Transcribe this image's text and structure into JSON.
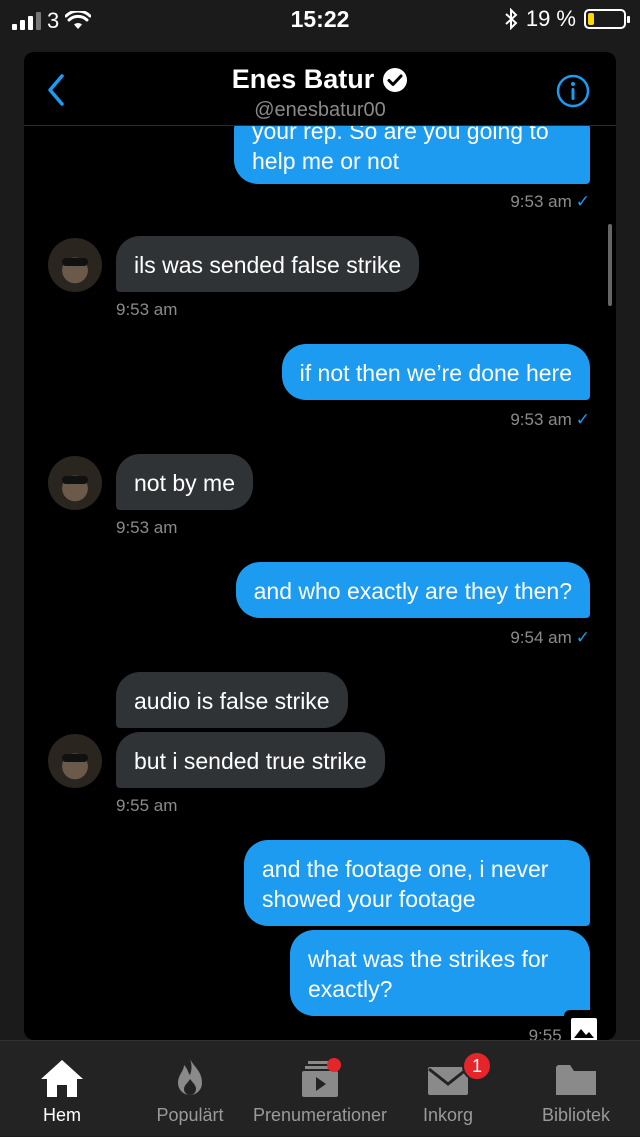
{
  "status_bar": {
    "carrier": "3",
    "time": "15:22",
    "battery_percent": "19 %",
    "battery_level": 0.19,
    "battery_color": "#ffd60a"
  },
  "header": {
    "name": "Enes Batur",
    "handle": "@enesbatur00",
    "verified": true
  },
  "messages": [
    {
      "type": "sent",
      "text": "your rep. So are you going to help me or not",
      "time": "9:53 am",
      "check": "✓"
    },
    {
      "type": "received",
      "text": "ils was sended false strike",
      "time": "9:53 am"
    },
    {
      "type": "sent",
      "text": "if not then we’re done here",
      "time": "9:53 am",
      "check": "✓"
    },
    {
      "type": "received",
      "text": "not by me",
      "time": "9:53 am"
    },
    {
      "type": "sent",
      "text": "and who exactly are they then?",
      "time": "9:54 am",
      "check": "✓"
    },
    {
      "type": "received",
      "text": "audio is false strike"
    },
    {
      "type": "received",
      "text": "but i sended true strike",
      "time": "9:55 am"
    },
    {
      "type": "sent",
      "text": "and the footage one, i never showed your footage"
    },
    {
      "type": "sent",
      "text": "what was the strikes for exactly?",
      "time": "9:55 am"
    }
  ],
  "tabbar": {
    "tabs": [
      {
        "label": "Hem",
        "icon": "home-icon",
        "active": true
      },
      {
        "label": "Populärt",
        "icon": "flame-icon"
      },
      {
        "label": "Prenumerationer",
        "icon": "subscriptions-icon"
      },
      {
        "label": "Inkorg",
        "icon": "mail-icon",
        "badge": "1"
      },
      {
        "label": "Bibliotek",
        "icon": "folder-icon"
      }
    ]
  },
  "colors": {
    "sent_bubble": "#1d9bf0",
    "received_bubble": "#2f3336",
    "badge": "#e5252a"
  }
}
